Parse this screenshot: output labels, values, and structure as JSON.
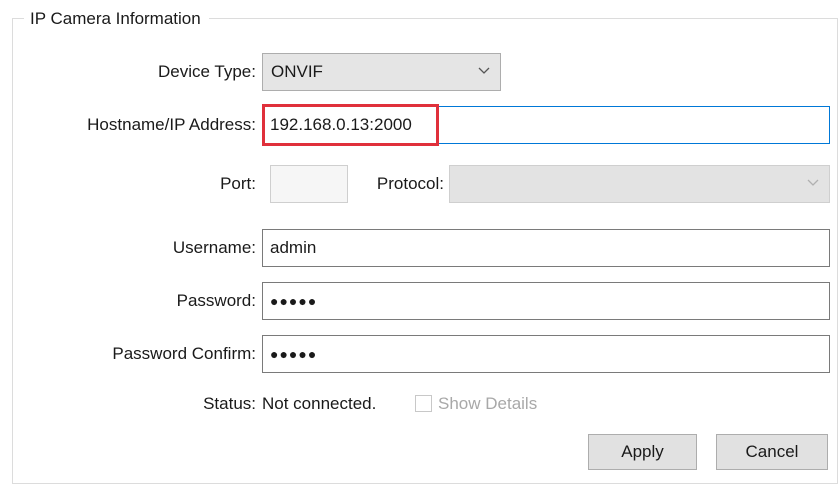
{
  "group": {
    "title": "IP Camera Information"
  },
  "device_type": {
    "label": "Device Type:",
    "value": "ONVIF"
  },
  "hostname": {
    "label": "Hostname/IP Address:",
    "value": "192.168.0.13:2000"
  },
  "port": {
    "label": "Port:",
    "value": ""
  },
  "protocol": {
    "label": "Protocol:",
    "value": ""
  },
  "username": {
    "label": "Username:",
    "value": "admin"
  },
  "password": {
    "label": "Password:",
    "value": "●●●●●"
  },
  "password_confirm": {
    "label": "Password Confirm:",
    "value": "●●●●●"
  },
  "status": {
    "label": "Status:",
    "value": "Not connected.",
    "show_details_label": "Show Details"
  },
  "buttons": {
    "apply": "Apply",
    "cancel": "Cancel"
  },
  "colors": {
    "highlight": "#e0303b",
    "focus_border": "#0078d7"
  }
}
